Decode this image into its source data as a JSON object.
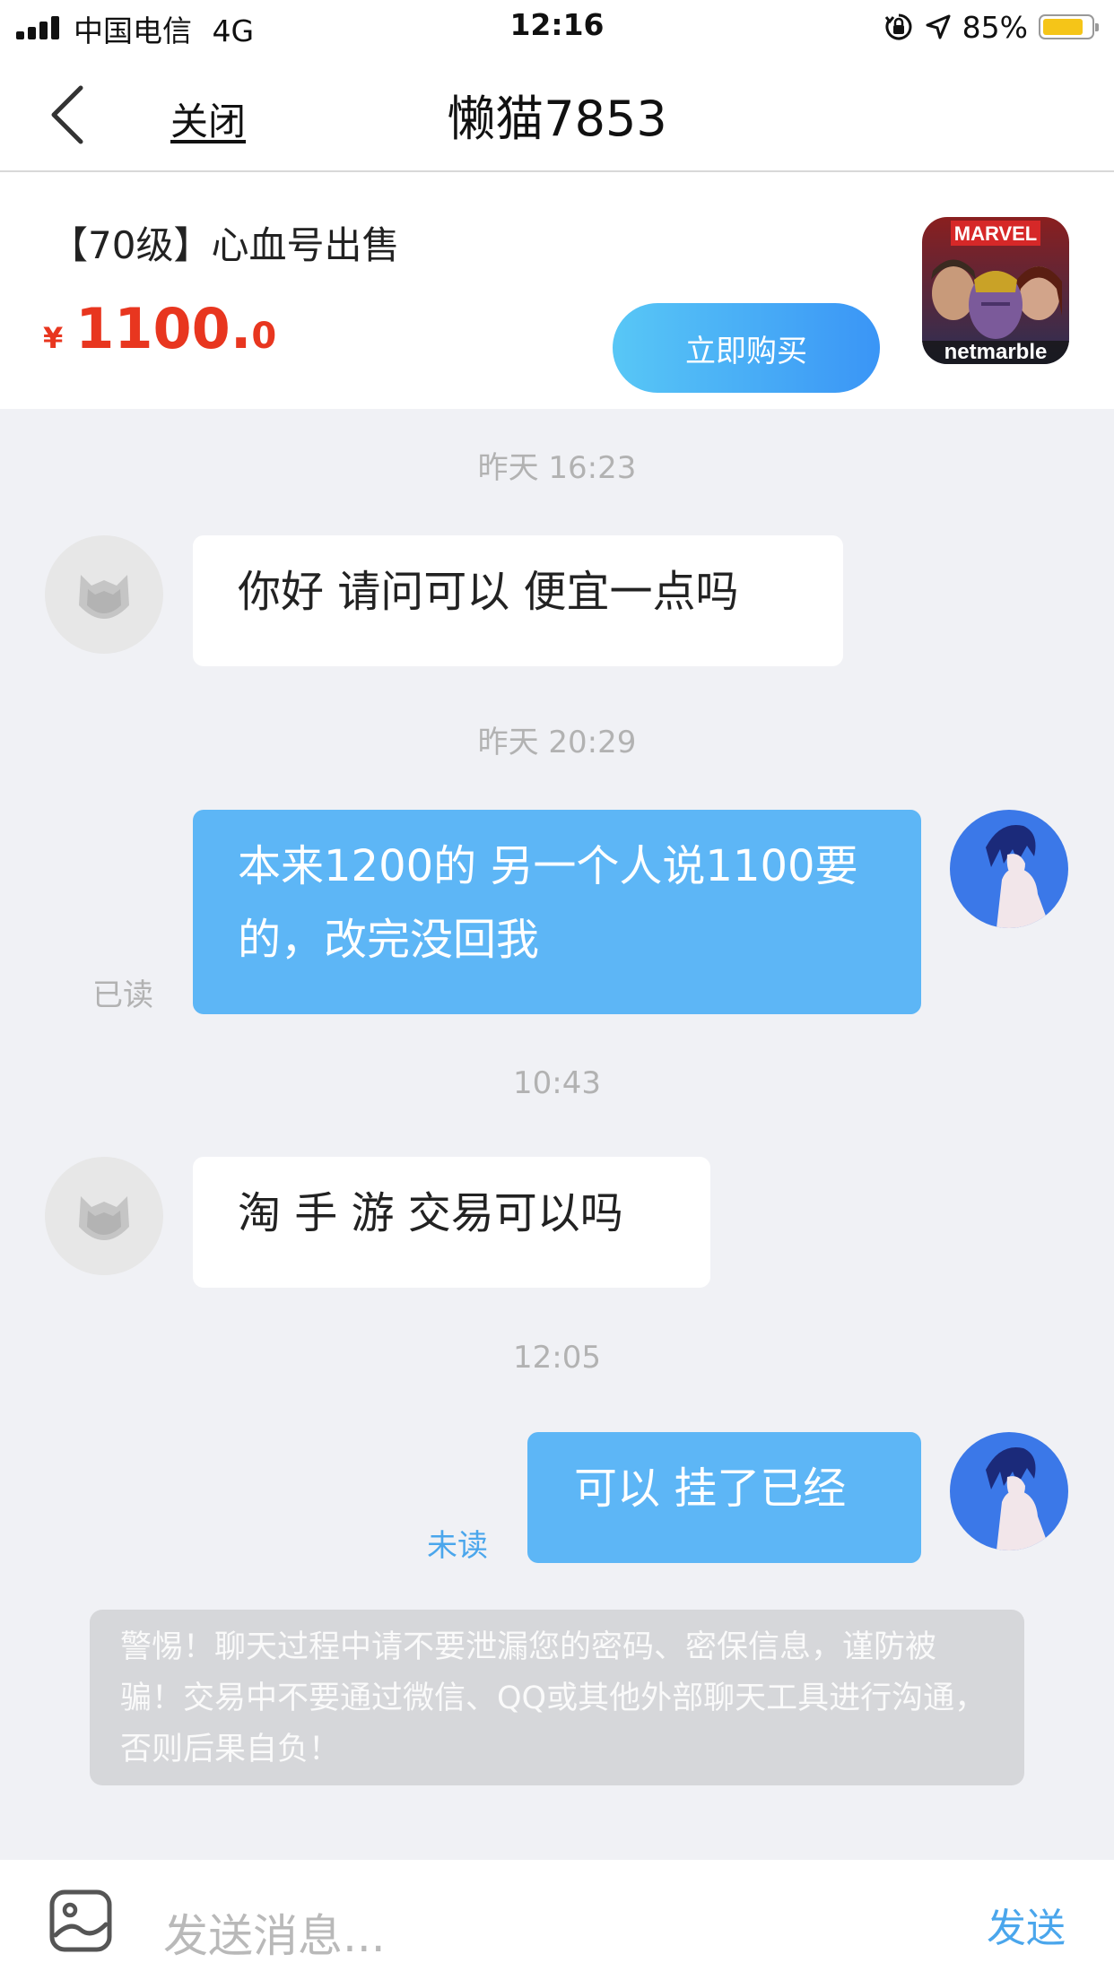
{
  "status_bar": {
    "carrier": "中国电信",
    "network": "4G",
    "time": "12:16",
    "battery_percent": "85%",
    "battery_level": 0.85
  },
  "nav": {
    "close_label": "关闭",
    "title": "懒猫7853"
  },
  "product": {
    "title": "【70级】心血号出售",
    "currency": "¥",
    "price_integer": "1100.",
    "price_decimal": "0",
    "buy_label": "立即购买",
    "thumb_top_text": "MARVEL",
    "thumb_bottom_text": "netmarble"
  },
  "messages": [
    {
      "timestamp": "昨天 16:23",
      "direction": "incoming",
      "text": "你好 请问可以 便宜一点吗"
    },
    {
      "timestamp": "昨天 20:29",
      "direction": "outgoing",
      "text": "本来1200的 另一个人说1100要的，改完没回我",
      "status": "已读"
    },
    {
      "timestamp": "10:43",
      "direction": "incoming",
      "text": "淘 手 游 交易可以吗"
    },
    {
      "timestamp": "12:05",
      "direction": "outgoing",
      "text": "可以 挂了已经",
      "status": "未读"
    }
  ],
  "warning": "警惕！聊天过程中请不要泄漏您的密码、密保信息，谨防被骗！交易中不要通过微信、QQ或其他外部聊天工具进行沟通，否则后果自负！",
  "input": {
    "placeholder": "发送消息...",
    "send_label": "发送"
  },
  "colors": {
    "accent": "#5db6f6",
    "price": "#e8361f",
    "background": "#f0f1f5",
    "read_status": "#b2b2b2",
    "unread_status": "#4aa6ec"
  }
}
